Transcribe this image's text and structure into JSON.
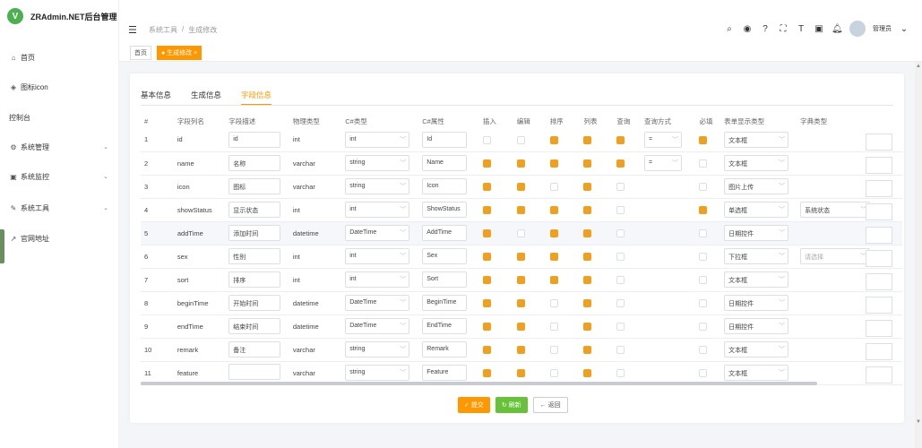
{
  "app": {
    "logo_letter": "V",
    "title": "ZRAdmin.NET后台管理"
  },
  "sidebar": {
    "items": [
      {
        "label": "首页",
        "icon": "⌂"
      },
      {
        "label": "图标icon",
        "icon": "◈"
      },
      {
        "label": "控制台",
        "icon": ""
      },
      {
        "label": "系统管理",
        "icon": "⚙",
        "chevron": "⌄"
      },
      {
        "label": "系统监控",
        "icon": "▣",
        "chevron": "⌄"
      },
      {
        "label": "系统工具",
        "icon": "✎",
        "chevron": "⌄"
      },
      {
        "label": "官网地址",
        "icon": "↗"
      }
    ]
  },
  "header": {
    "breadcrumb": [
      "系统工具",
      "/",
      "生成修改"
    ],
    "user": "管理员"
  },
  "tagsview": {
    "home": "首页",
    "active": "● 生成修改 ×"
  },
  "tabs": [
    "基本信息",
    "生成信息",
    "字段信息"
  ],
  "table": {
    "headers": [
      "#",
      "字段列名",
      "字段描述",
      "物理类型",
      "C#类型",
      "C#属性",
      "插入",
      "编辑",
      "排序",
      "列表",
      "查询",
      "查询方式",
      "必填",
      "表单显示类型",
      "字典类型"
    ],
    "rows": [
      {
        "n": "1",
        "col": "id",
        "desc": "id",
        "ptype": "int",
        "ctype": "int",
        "cprop": "Id",
        "ins": false,
        "edit": false,
        "sort": true,
        "list": true,
        "query": true,
        "qtype": "=",
        "req": true,
        "html": "文本框",
        "dict": ""
      },
      {
        "n": "2",
        "col": "name",
        "desc": "名称",
        "ptype": "varchar",
        "ctype": "string",
        "cprop": "Name",
        "ins": true,
        "edit": true,
        "sort": true,
        "list": true,
        "query": true,
        "qtype": "=",
        "req": false,
        "html": "文本框",
        "dict": ""
      },
      {
        "n": "3",
        "col": "icon",
        "desc": "图标",
        "ptype": "varchar",
        "ctype": "string",
        "cprop": "Icon",
        "ins": true,
        "edit": true,
        "sort": false,
        "list": true,
        "query": false,
        "qtype": "",
        "req": false,
        "html": "图片上传",
        "dict": ""
      },
      {
        "n": "4",
        "col": "showStatus",
        "desc": "显示状态",
        "ptype": "int",
        "ctype": "int",
        "cprop": "ShowStatus",
        "ins": true,
        "edit": true,
        "sort": true,
        "list": true,
        "query": false,
        "qtype": "",
        "req": true,
        "html": "单选框",
        "dict": "系统状态"
      },
      {
        "n": "5",
        "col": "addTime",
        "desc": "添加时间",
        "ptype": "datetime",
        "ctype": "DateTime",
        "cprop": "AddTime",
        "ins": true,
        "edit": false,
        "sort": true,
        "list": true,
        "query": false,
        "qtype": "",
        "req": false,
        "html": "日期控件",
        "dict": ""
      },
      {
        "n": "6",
        "col": "sex",
        "desc": "性别",
        "ptype": "int",
        "ctype": "int",
        "cprop": "Sex",
        "ins": true,
        "edit": true,
        "sort": true,
        "list": true,
        "query": false,
        "qtype": "",
        "req": false,
        "html": "下拉框",
        "dict": "",
        "dict_placeholder": "请选择"
      },
      {
        "n": "7",
        "col": "sort",
        "desc": "排序",
        "ptype": "int",
        "ctype": "int",
        "cprop": "Sort",
        "ins": true,
        "edit": true,
        "sort": true,
        "list": true,
        "query": false,
        "qtype": "",
        "req": false,
        "html": "文本框",
        "dict": ""
      },
      {
        "n": "8",
        "col": "beginTime",
        "desc": "开始时间",
        "ptype": "datetime",
        "ctype": "DateTime",
        "cprop": "BeginTime",
        "ins": true,
        "edit": true,
        "sort": false,
        "list": true,
        "query": false,
        "qtype": "",
        "req": false,
        "html": "日期控件",
        "dict": ""
      },
      {
        "n": "9",
        "col": "endTime",
        "desc": "结束时间",
        "ptype": "datetime",
        "ctype": "DateTime",
        "cprop": "EndTime",
        "ins": true,
        "edit": true,
        "sort": false,
        "list": true,
        "query": false,
        "qtype": "",
        "req": false,
        "html": "日期控件",
        "dict": ""
      },
      {
        "n": "10",
        "col": "remark",
        "desc": "备注",
        "ptype": "varchar",
        "ctype": "string",
        "cprop": "Remark",
        "ins": true,
        "edit": true,
        "sort": false,
        "list": true,
        "query": false,
        "qtype": "",
        "req": false,
        "html": "文本框",
        "dict": ""
      },
      {
        "n": "11",
        "col": "feature",
        "desc": "",
        "ptype": "varchar",
        "ctype": "string",
        "cprop": "Feature",
        "ins": true,
        "edit": true,
        "sort": false,
        "list": true,
        "query": false,
        "qtype": "",
        "req": false,
        "html": "文本框",
        "dict": ""
      }
    ]
  },
  "buttons": {
    "submit": "✓ 提交",
    "refresh": "↻ 刷新",
    "back": "← 返回"
  },
  "colors": {
    "accent": "#ff9800",
    "success": "#67c23a",
    "brand": "#4caf50"
  }
}
